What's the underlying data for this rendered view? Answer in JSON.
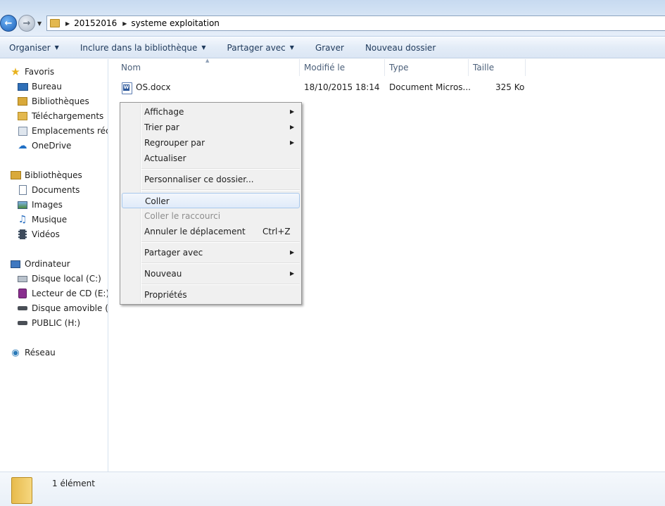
{
  "address": {
    "breadcrumbs": [
      "20152016",
      "systeme exploitation"
    ]
  },
  "toolbar": {
    "organiser": "Organiser",
    "include_library": "Inclure dans la bibliothèque",
    "share_with": "Partager avec",
    "burn": "Graver",
    "new_folder": "Nouveau dossier"
  },
  "navigation": {
    "favorites": {
      "label": "Favoris",
      "items": [
        "Bureau",
        "Bibliothèques",
        "Téléchargements",
        "Emplacements réce",
        "OneDrive"
      ]
    },
    "libraries": {
      "label": "Bibliothèques",
      "items": [
        "Documents",
        "Images",
        "Musique",
        "Vidéos"
      ]
    },
    "computer": {
      "label": "Ordinateur",
      "items": [
        "Disque local (C:)",
        "Lecteur de CD (E:) M",
        "Disque amovible (F:)",
        "PUBLIC (H:)"
      ]
    },
    "network": {
      "label": "Réseau"
    }
  },
  "columns": {
    "name": "Nom",
    "modified": "Modifié le",
    "type": "Type",
    "size": "Taille"
  },
  "files": [
    {
      "name": "OS.docx",
      "modified": "18/10/2015 18:14",
      "type": "Document Micros...",
      "size": "325 Ko"
    }
  ],
  "context_menu": {
    "view": "Affichage",
    "sort_by": "Trier par",
    "group_by": "Regrouper par",
    "refresh": "Actualiser",
    "customize": "Personnaliser ce dossier...",
    "paste": "Coller",
    "paste_shortcut": "Coller le raccourci",
    "undo_move": "Annuler le déplacement",
    "undo_shortcut": "Ctrl+Z",
    "share_with": "Partager avec",
    "new": "Nouveau",
    "properties": "Propriétés"
  },
  "details": {
    "item_count": "1 élément"
  },
  "colors": {
    "toolbar_text": "#1e395b",
    "hover_border": "#a8c8ec",
    "disabled_text": "#8d8d8d"
  }
}
